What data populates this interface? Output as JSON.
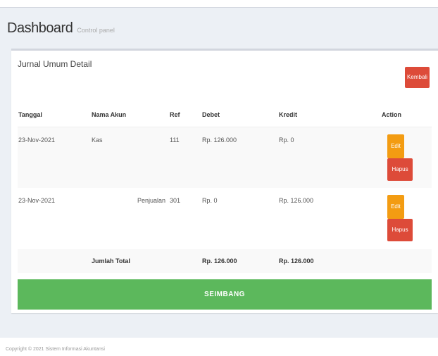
{
  "header": {
    "title": "Dashboard",
    "subtitle": "Control panel"
  },
  "box": {
    "title": "Jurnal Umum Detail",
    "back_label": "Kembali"
  },
  "table": {
    "headers": [
      "Tanggal",
      "Nama Akun",
      "Ref",
      "Debet",
      "Kredit",
      "Action"
    ],
    "rows": [
      {
        "tanggal": "23-Nov-2021",
        "nama_akun": "Kas",
        "ref": "111",
        "debet": "Rp. 126.000",
        "kredit": "Rp. 0",
        "edit_label": "Edit",
        "hapus_label": "Hapus"
      },
      {
        "tanggal": "23-Nov-2021",
        "nama_akun": "Penjualan",
        "ref": "301",
        "debet": "Rp. 0",
        "kredit": "Rp. 126.000",
        "edit_label": "Edit",
        "hapus_label": "Hapus"
      }
    ],
    "total": {
      "label": "Jumlah Total",
      "debet": "Rp. 126.000",
      "kredit": "Rp. 126.000"
    }
  },
  "status": {
    "label": "SEIMBANG",
    "color": "#5cb85c"
  },
  "footer": {
    "text": "Copyright © 2021 Sistem Informasi Akuntansi"
  }
}
